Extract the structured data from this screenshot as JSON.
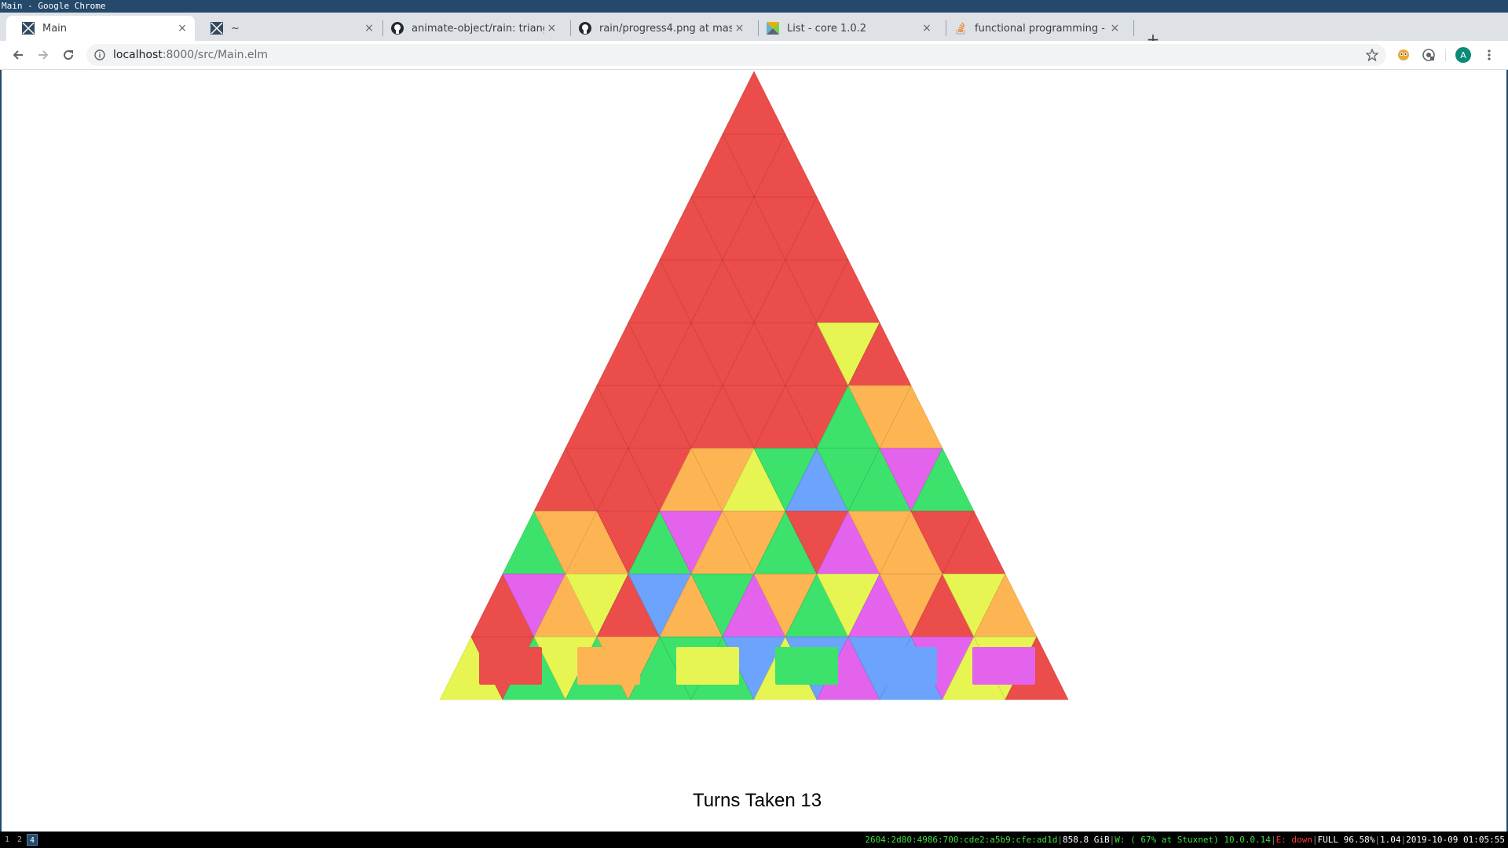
{
  "window_title": "Main - Google Chrome",
  "tabs": [
    {
      "title": "Main",
      "favicon": "elm-icon",
      "active": true
    },
    {
      "title": "~",
      "favicon": "elm-icon",
      "active": false
    },
    {
      "title": "animate-object/rain: triang",
      "favicon": "github-icon",
      "active": false
    },
    {
      "title": "rain/progress4.png at mast",
      "favicon": "github-icon",
      "active": false
    },
    {
      "title": "List - core 1.0.2",
      "favicon": "elm-package-icon",
      "active": false
    },
    {
      "title": "functional programming - I",
      "favicon": "stackoverflow-icon",
      "active": false
    }
  ],
  "new_tab_label": "+",
  "tab_close_label": "×",
  "omnibox": {
    "host": "localhost",
    "rest": ":8000/src/Main.elm"
  },
  "colors": {
    "red": "#eb4d4b",
    "orange": "#fdb554",
    "yellow": "#e7f553",
    "green": "#3ce26b",
    "blue": "#6ba3fd",
    "purple": "#e463ed"
  },
  "palette": [
    "red",
    "orange",
    "yellow",
    "green",
    "blue",
    "purple"
  ],
  "board": {
    "rows": [
      [
        "R"
      ],
      [
        "R",
        "R",
        "R"
      ],
      [
        "R",
        "R",
        "R",
        "R",
        "R"
      ],
      [
        "R",
        "R",
        "R",
        "R",
        "R",
        "R",
        "R"
      ],
      [
        "R",
        "R",
        "R",
        "R",
        "R",
        "R",
        "R",
        "Y",
        "R"
      ],
      [
        "R",
        "R",
        "R",
        "R",
        "R",
        "R",
        "R",
        "R",
        "G",
        "O",
        "O"
      ],
      [
        "R",
        "R",
        "R",
        "R",
        "O",
        "O",
        "Y",
        "G",
        "B",
        "G",
        "G",
        "P",
        "G"
      ],
      [
        "G",
        "O",
        "O",
        "R",
        "G",
        "P",
        "O",
        "O",
        "G",
        "R",
        "P",
        "O",
        "O",
        "R",
        "R"
      ],
      [
        "R",
        "P",
        "O",
        "Y",
        "R",
        "B",
        "O",
        "G",
        "P",
        "O",
        "G",
        "Y",
        "P",
        "O",
        "R",
        "Y",
        "O"
      ],
      [
        "Y",
        "R",
        "G",
        "Y",
        "G",
        "O",
        "G",
        "G",
        "G",
        "B",
        "Y",
        "B",
        "P",
        "B",
        "B",
        "P",
        "Y",
        "Y",
        "R"
      ]
    ]
  },
  "turns_label": "Turns Taken",
  "turns": "13",
  "status": {
    "workspaces": [
      "1",
      "2",
      "4"
    ],
    "active_workspace": "4",
    "ipv6": "2604:2d80:4986:700:cde2:a5b9:cfe:ad1d",
    "disk": "858.8 GiB",
    "wifi": "W: ( 67% at Stuxnet) 10.0.0.14",
    "ethernet": "E: down",
    "battery": "FULL 96.58%",
    "load": "1.04",
    "datetime": "2019-10-09 01:05:55"
  }
}
